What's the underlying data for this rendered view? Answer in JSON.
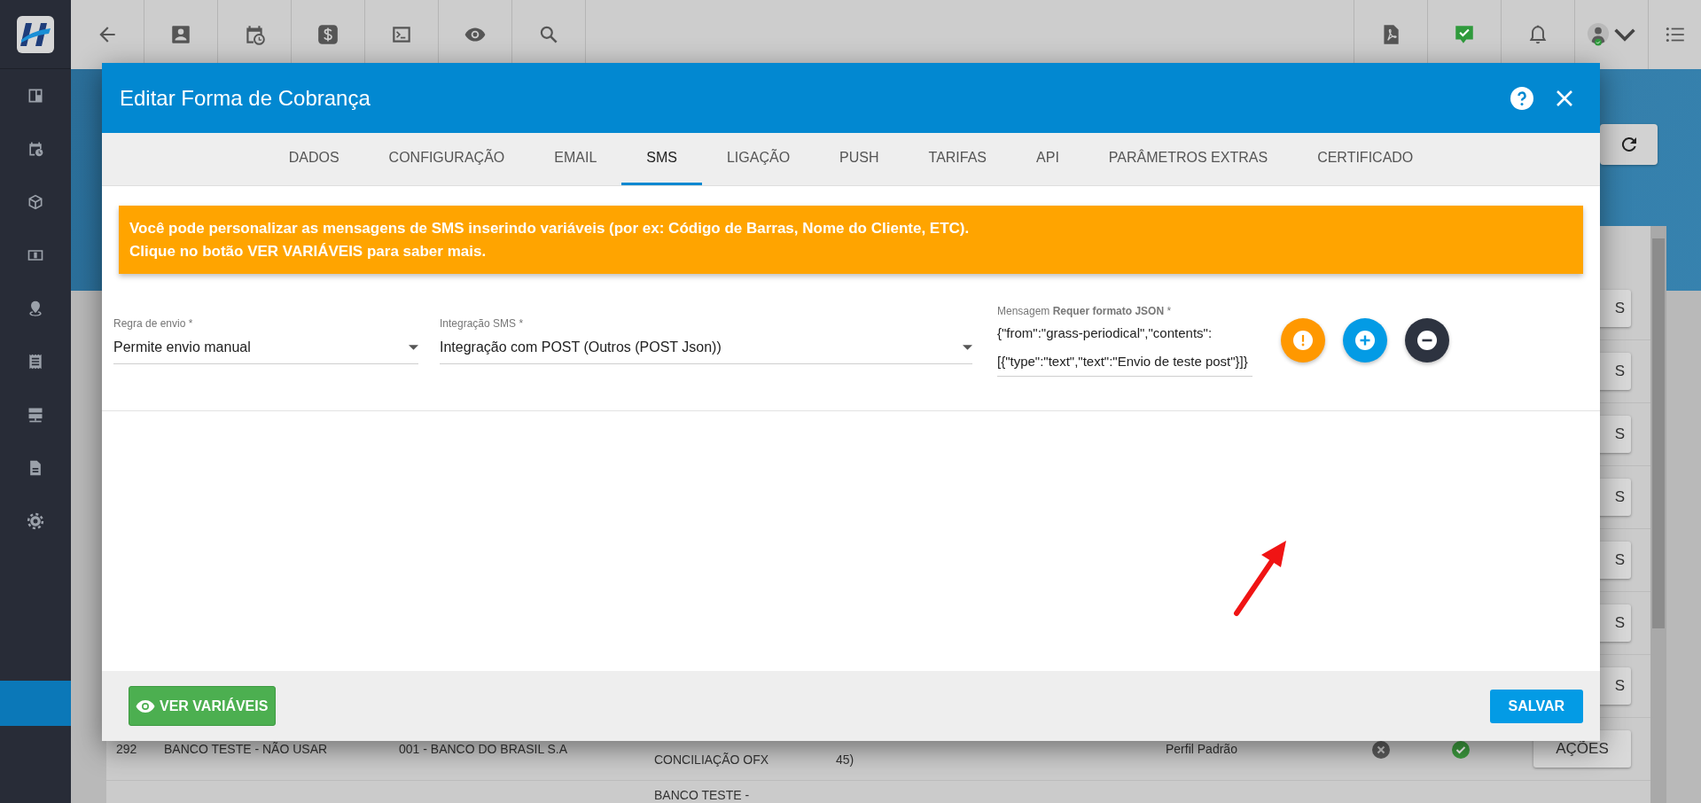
{
  "table": {
    "rows": [
      {
        "action": "S"
      },
      {
        "action": "S"
      },
      {
        "action": "S"
      },
      {
        "action": "S"
      },
      {
        "action": "S"
      },
      {
        "action": "S"
      },
      {
        "action": "S"
      },
      {
        "id": "292",
        "name": "BANCO TESTE - NÃO USAR",
        "bank": "001 - BANCO DO BRASIL S.A",
        "column_4": "CONCILIAÇÃO OFX",
        "column_5": "45)",
        "profile": "Perfil Padrão",
        "column_7": false,
        "column_8": true,
        "action": "AÇÕES"
      },
      {
        "column_4": "BANCO TESTE -"
      }
    ]
  },
  "modal": {
    "title": "Editar Forma de Cobrança",
    "tabs": [
      {
        "label": "DADOS",
        "selected": false
      },
      {
        "label": "CONFIGURAÇÃO",
        "selected": false
      },
      {
        "label": "EMAIL",
        "selected": false
      },
      {
        "label": "SMS",
        "selected": true
      },
      {
        "label": "LIGAÇÃO",
        "selected": false
      },
      {
        "label": "PUSH",
        "selected": false
      },
      {
        "label": "TARIFAS",
        "selected": false
      },
      {
        "label": "API",
        "selected": false
      },
      {
        "label": "PARÂMETROS EXTRAS",
        "selected": false
      },
      {
        "label": "CERTIFICADO",
        "selected": false
      }
    ],
    "alert": {
      "lines": [
        "Você pode personalizar as mensagens de SMS inserindo variáveis (por ex: Código de Barras, Nome do Cliente, ETC).",
        "Clique no botão VER VARIÁVEIS para saber mais."
      ]
    },
    "fields": [
      {
        "kind": "select",
        "label": "Regra de envio *",
        "value": "Permite envio manual"
      },
      {
        "kind": "select",
        "label": "Integração SMS *",
        "value": "Integração com POST (Outros (POST Json))"
      },
      {
        "kind": "textarea",
        "label": "Mensagem **Requer formato JSON** *",
        "value": "{\"from\":\"grass-periodical\",\"contents\":[{\"type\":\"text\",\"text\":\"Envio de teste post\"}]}"
      }
    ],
    "actions": [
      {
        "kind": "warning"
      },
      {
        "kind": "add"
      },
      {
        "kind": "remove"
      }
    ],
    "footer": {
      "buttons": [
        {
          "kind": "variables",
          "label": "VER VARIÁVEIS"
        },
        {
          "kind": "save",
          "label": "SALVAR"
        }
      ]
    }
  }
}
